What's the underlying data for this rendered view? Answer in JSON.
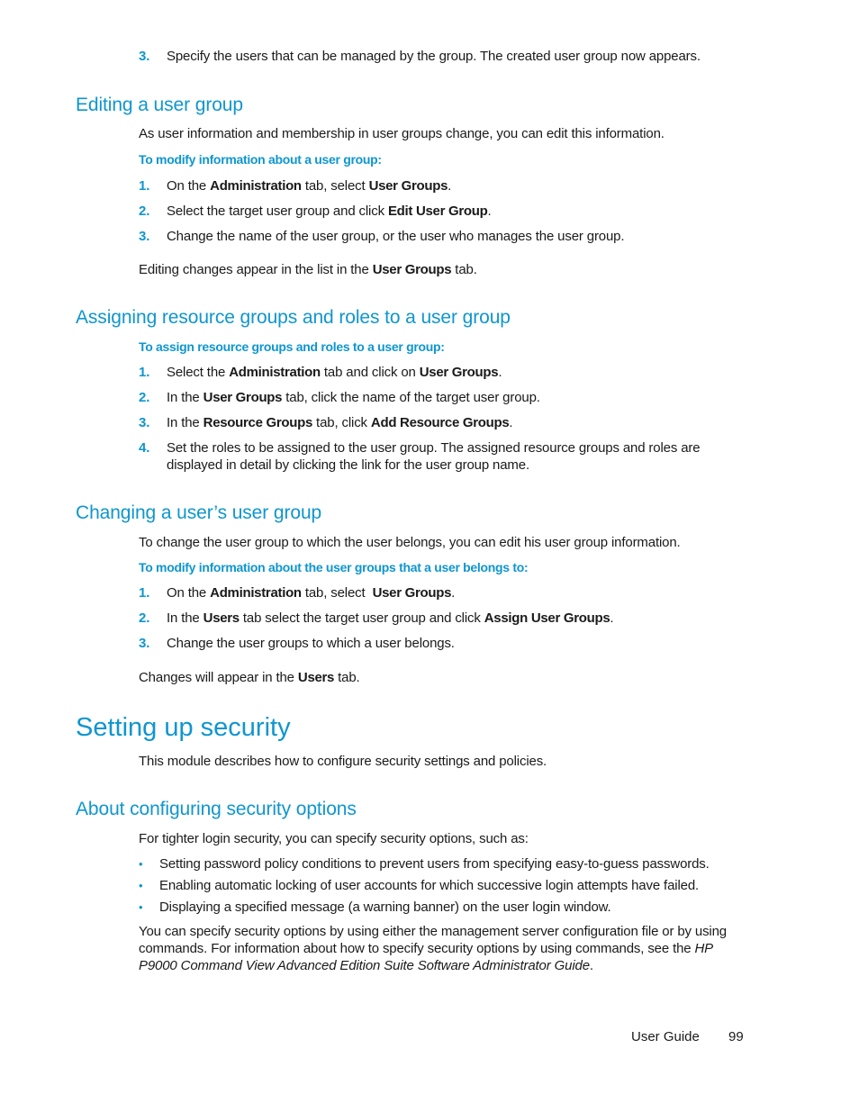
{
  "top_step": {
    "num": "3.",
    "text": "Specify the users that can be managed by the group. The created user group now appears."
  },
  "editing": {
    "heading": "Editing a user group",
    "intro": "As user information and membership in user groups change, you can edit this information.",
    "procedure": "To modify information about a user group:",
    "steps": [
      {
        "num": "1.",
        "t1": "On the ",
        "b1": "Administration",
        "t2": " tab, select ",
        "b2": "User Groups",
        "t3": "."
      },
      {
        "num": "2.",
        "t1": "Select the target user group and click ",
        "b1": "Edit User Group",
        "t2": "."
      },
      {
        "num": "3.",
        "t1": "Change the name of the user group, or the user who manages the user group."
      }
    ],
    "outro": {
      "t1": "Editing changes appear in the list in the ",
      "b1": "User Groups",
      "t2": " tab."
    }
  },
  "assigning": {
    "heading": "Assigning resource groups and roles to a user group",
    "procedure": "To assign resource groups and roles to a user group:",
    "steps": [
      {
        "num": "1.",
        "t1": "Select the ",
        "b1": "Administration",
        "t2": " tab and click on ",
        "b2": "User Groups",
        "t3": "."
      },
      {
        "num": "2.",
        "t1": "In the ",
        "b1": "User Groups",
        "t2": " tab, click the name of the target user group."
      },
      {
        "num": "3.",
        "t1": "In the ",
        "b1": "Resource Groups",
        "t2": " tab, click ",
        "b2": "Add Resource Groups",
        "t3": "."
      },
      {
        "num": "4.",
        "line1": "Set the roles to be assigned to the user group. The assigned resource groups and roles are",
        "line2": "displayed in detail by clicking the link for the user group name."
      }
    ]
  },
  "changing": {
    "heading": "Changing a user’s user group",
    "intro": "To change the user group to which the user belongs, you can edit his user group information.",
    "procedure": "To modify information about the user groups that a user belongs to:",
    "steps": [
      {
        "num": "1.",
        "t1": "On the ",
        "b1": "Administration",
        "t2": " tab, select  ",
        "b2": "User Groups",
        "t3": "."
      },
      {
        "num": "2.",
        "t1": "In the ",
        "b1": "Users",
        "t2": " tab select the target user group and click ",
        "b2": "Assign User Groups",
        "t3": "."
      },
      {
        "num": "3.",
        "t1": "Change the user groups to which a user belongs."
      }
    ],
    "outro": {
      "t1": "Changes will appear in the ",
      "b1": "Users",
      "t2": " tab."
    }
  },
  "security": {
    "heading": "Setting up security",
    "intro": "This module describes how to configure security settings and policies."
  },
  "about": {
    "heading": "About configuring security options",
    "intro": "For tighter login security, you can specify security options, such as:",
    "bullets": [
      "Setting password policy conditions to prevent users from specifying easy-to-guess passwords.",
      "Enabling automatic locking of user accounts for which successive login attempts have failed.",
      "Displaying a specified message (a warning banner) on the user login window."
    ],
    "bullet_glyph": "•",
    "closing": {
      "line1": "You can specify security options by using either the management server configuration file or by using",
      "line2_pre": "commands. For information about how to specify security options by using commands, see the ",
      "line2_ital": "HP",
      "line3_ital": "P9000 Command View Advanced Edition Suite Software Administrator Guide",
      "line3_post": "."
    }
  },
  "footer": {
    "label": "User Guide",
    "page": "99"
  },
  "colors": {
    "accent": "#0e96cf",
    "text": "#1a1a1a"
  }
}
